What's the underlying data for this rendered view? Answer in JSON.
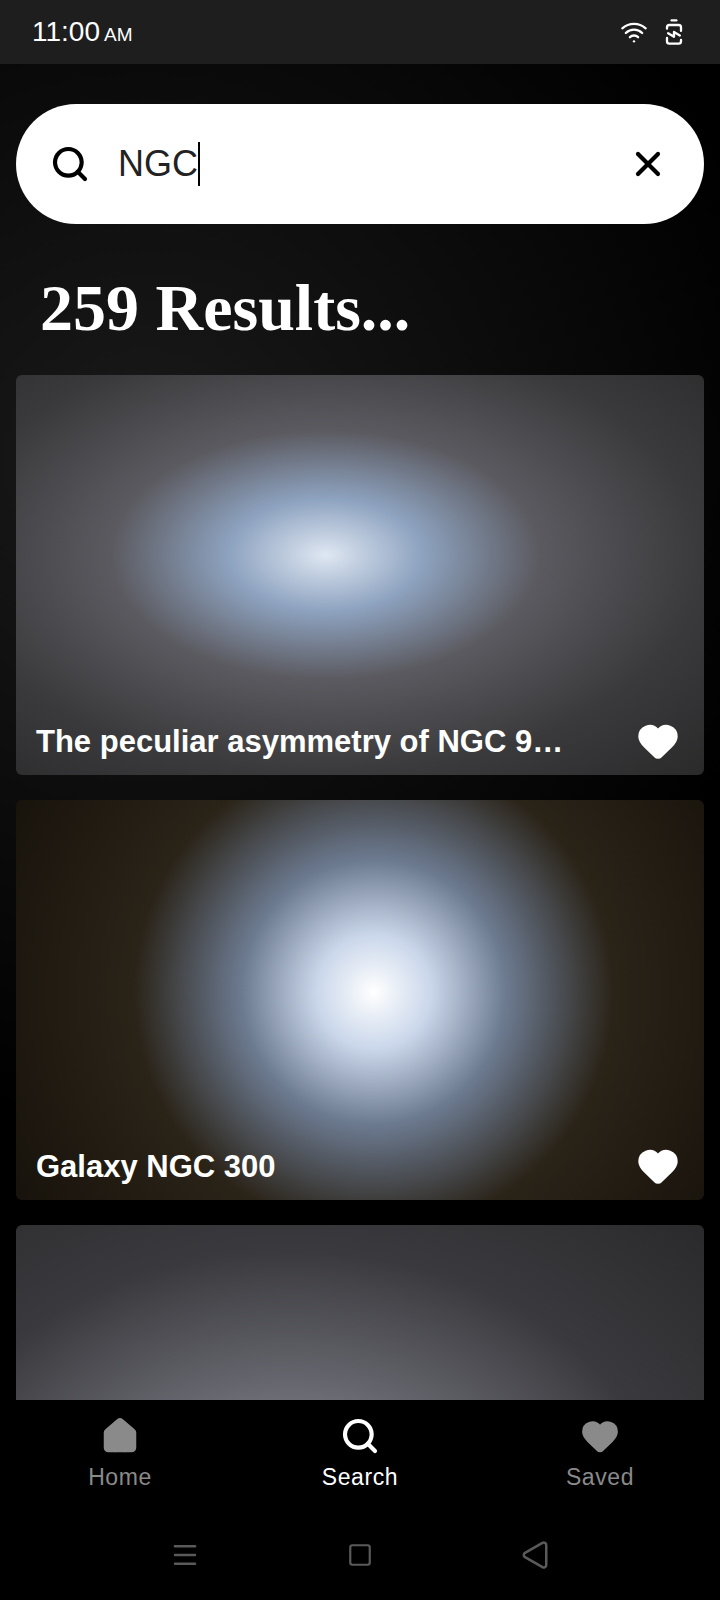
{
  "status_bar": {
    "time": "11:00",
    "ampm": "AM"
  },
  "search": {
    "query": "NGC"
  },
  "results_heading": "259 Results...",
  "results": [
    {
      "kind": "full",
      "title": "The peculiar asymmetry of NGC 9…"
    },
    {
      "kind": "full",
      "title": "Galaxy NGC 300"
    },
    {
      "kind": "partial"
    }
  ],
  "nav": [
    {
      "label": "Home",
      "selected": false
    },
    {
      "label": "Search",
      "selected": true
    },
    {
      "label": "Saved",
      "selected": false
    }
  ]
}
